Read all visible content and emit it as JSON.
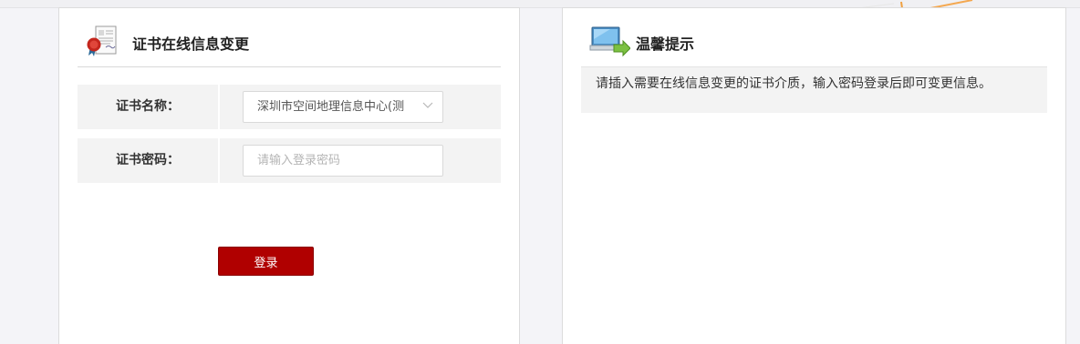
{
  "left_panel": {
    "title": "证书在线信息变更",
    "icon": "certificate-seal-icon",
    "cert_name_label": "证书名称：",
    "cert_name_value": "深圳市空间地理信息中心(测",
    "cert_password_label": "证书密码：",
    "cert_password_placeholder": "请输入登录密码",
    "login_label": "登录"
  },
  "right_panel": {
    "title": "温馨提示",
    "icon": "computer-monitor-icon",
    "tip_text": "请插入需要在线信息变更的证书介质，输入密码登录后即可变更信息。"
  },
  "colors": {
    "primary_button": "#b00000",
    "panel_background": "#ffffff",
    "page_background": "#f4f4f8",
    "row_background": "#f3f3f3"
  }
}
